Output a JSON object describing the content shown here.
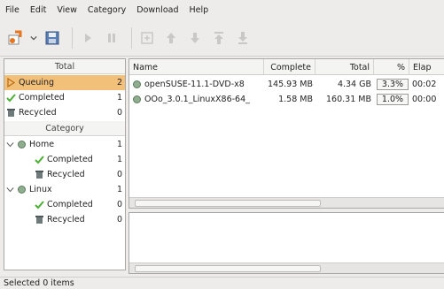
{
  "menu": [
    "File",
    "Edit",
    "View",
    "Category",
    "Download",
    "Help"
  ],
  "toolbar": {
    "icons": [
      "new-download-icon",
      "dropdown-icon",
      "save-icon",
      "start-icon",
      "pause-icon",
      "properties-icon",
      "move-up-icon",
      "move-down-icon",
      "move-top-icon",
      "move-bottom-icon"
    ]
  },
  "sidebar": {
    "total_header": "Total",
    "states": [
      {
        "label": "Queuing",
        "count": "2"
      },
      {
        "label": "Completed",
        "count": "1"
      },
      {
        "label": "Recycled",
        "count": "0"
      }
    ],
    "category_header": "Category",
    "categories": [
      {
        "label": "Home",
        "count": "1",
        "children": [
          {
            "label": "Completed",
            "count": "1"
          },
          {
            "label": "Recycled",
            "count": "0"
          }
        ]
      },
      {
        "label": "Linux",
        "count": "1",
        "children": [
          {
            "label": "Completed",
            "count": "0"
          },
          {
            "label": "Recycled",
            "count": "0"
          }
        ]
      }
    ]
  },
  "table": {
    "columns": [
      "Name",
      "Complete",
      "Total",
      "%",
      "Elap"
    ],
    "rows": [
      {
        "name": "openSUSE-11.1-DVD-x8",
        "complete": "145.93 MB",
        "total": "4.34 GB",
        "percent": "3.3%",
        "elapsed": "00:02"
      },
      {
        "name": "OOo_3.0.1_LinuxX86-64_",
        "complete": "1.58 MB",
        "total": "160.31 MB",
        "percent": "1.0%",
        "elapsed": "00:00"
      }
    ]
  },
  "status": "Selected 0 items",
  "colors": {
    "selected_row": "#f3c07a",
    "accent_orange": "#e5751f",
    "check_green": "#4caf35"
  }
}
